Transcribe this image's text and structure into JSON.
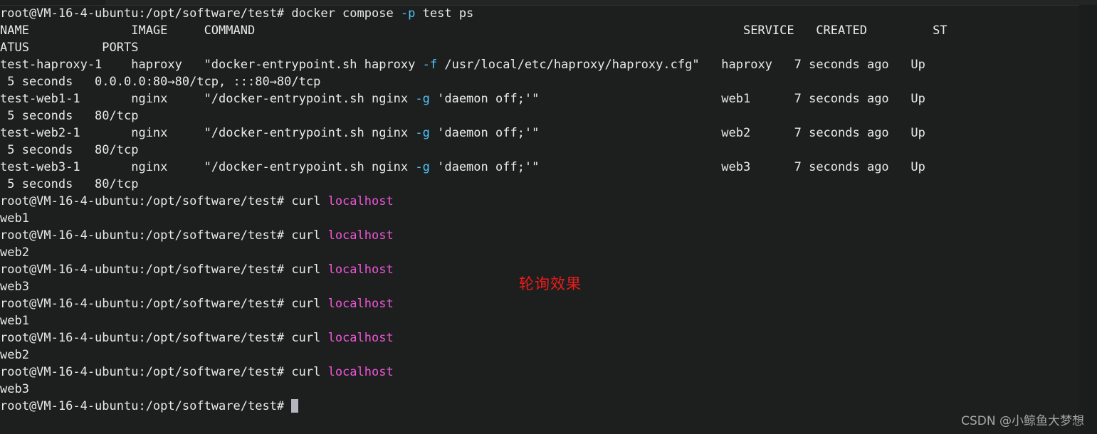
{
  "terminal": {
    "background_color": "#1d1f1f",
    "foreground_color": "#e9e9e9",
    "accent_cyan": "#4fc3f7",
    "accent_magenta": "#f056d9",
    "annotation_color": "#ee1b1b",
    "prompt": "root@VM-16-4-ubuntu:/opt/software/test#",
    "hostname": "VM-16-4-ubuntu",
    "user": "root",
    "cwd": "/opt/software/test"
  },
  "lines": [
    {
      "id": "line-0",
      "segments": [
        {
          "text": "root@VM-16-4-ubuntu:/opt/software/test# docker compose ",
          "color": "default"
        },
        {
          "text": "-p",
          "color": "cyan"
        },
        {
          "text": " test ps",
          "color": "default"
        }
      ]
    },
    {
      "id": "line-1",
      "segments": [
        {
          "text": "NAME              IMAGE     COMMAND                                                                   SERVICE   CREATED         ST",
          "color": "default"
        }
      ]
    },
    {
      "id": "line-2",
      "segments": [
        {
          "text": "ATUS          PORTS",
          "color": "default"
        }
      ]
    },
    {
      "id": "line-3",
      "segments": [
        {
          "text": "test-haproxy-1    haproxy   \"docker-entrypoint.sh haproxy ",
          "color": "default"
        },
        {
          "text": "-f",
          "color": "cyan"
        },
        {
          "text": " /usr/local/etc/haproxy/haproxy.cfg\"   haproxy   7 seconds ago   Up",
          "color": "default"
        }
      ]
    },
    {
      "id": "line-4",
      "segments": [
        {
          "text": " 5 seconds   0.0.0.0:80→80/tcp, :::80→80/tcp",
          "color": "default"
        }
      ]
    },
    {
      "id": "line-5",
      "segments": [
        {
          "text": "test-web1-1       nginx     \"/docker-entrypoint.sh nginx ",
          "color": "default"
        },
        {
          "text": "-g",
          "color": "cyan"
        },
        {
          "text": " 'daemon off;'\"                         web1      7 seconds ago   Up",
          "color": "default"
        }
      ]
    },
    {
      "id": "line-6",
      "segments": [
        {
          "text": " 5 seconds   80/tcp",
          "color": "default"
        }
      ]
    },
    {
      "id": "line-7",
      "segments": [
        {
          "text": "test-web2-1       nginx     \"/docker-entrypoint.sh nginx ",
          "color": "default"
        },
        {
          "text": "-g",
          "color": "cyan"
        },
        {
          "text": " 'daemon off;'\"                         web2      7 seconds ago   Up",
          "color": "default"
        }
      ]
    },
    {
      "id": "line-8",
      "segments": [
        {
          "text": " 5 seconds   80/tcp",
          "color": "default"
        }
      ]
    },
    {
      "id": "line-9",
      "segments": [
        {
          "text": "test-web3-1       nginx     \"/docker-entrypoint.sh nginx ",
          "color": "default"
        },
        {
          "text": "-g",
          "color": "cyan"
        },
        {
          "text": " 'daemon off;'\"                         web3      7 seconds ago   Up",
          "color": "default"
        }
      ]
    },
    {
      "id": "line-10",
      "segments": [
        {
          "text": " 5 seconds   80/tcp",
          "color": "default"
        }
      ]
    },
    {
      "id": "line-11",
      "segments": [
        {
          "text": "root@VM-16-4-ubuntu:/opt/software/test# curl ",
          "color": "default"
        },
        {
          "text": "localhost",
          "color": "magenta"
        }
      ]
    },
    {
      "id": "line-12",
      "segments": [
        {
          "text": "web1",
          "color": "default"
        }
      ]
    },
    {
      "id": "line-13",
      "segments": [
        {
          "text": "root@VM-16-4-ubuntu:/opt/software/test# curl ",
          "color": "default"
        },
        {
          "text": "localhost",
          "color": "magenta"
        }
      ]
    },
    {
      "id": "line-14",
      "segments": [
        {
          "text": "web2",
          "color": "default"
        }
      ]
    },
    {
      "id": "line-15",
      "segments": [
        {
          "text": "root@VM-16-4-ubuntu:/opt/software/test# curl ",
          "color": "default"
        },
        {
          "text": "localhost",
          "color": "magenta"
        }
      ]
    },
    {
      "id": "line-16",
      "segments": [
        {
          "text": "web3",
          "color": "default"
        }
      ]
    },
    {
      "id": "line-17",
      "segments": [
        {
          "text": "root@VM-16-4-ubuntu:/opt/software/test# curl ",
          "color": "default"
        },
        {
          "text": "localhost",
          "color": "magenta"
        }
      ]
    },
    {
      "id": "line-18",
      "segments": [
        {
          "text": "web1",
          "color": "default"
        }
      ]
    },
    {
      "id": "line-19",
      "segments": [
        {
          "text": "root@VM-16-4-ubuntu:/opt/software/test# curl ",
          "color": "default"
        },
        {
          "text": "localhost",
          "color": "magenta"
        }
      ]
    },
    {
      "id": "line-20",
      "segments": [
        {
          "text": "web2",
          "color": "default"
        }
      ]
    },
    {
      "id": "line-21",
      "segments": [
        {
          "text": "root@VM-16-4-ubuntu:/opt/software/test# curl ",
          "color": "default"
        },
        {
          "text": "localhost",
          "color": "magenta"
        }
      ]
    },
    {
      "id": "line-22",
      "segments": [
        {
          "text": "web3",
          "color": "default"
        }
      ]
    },
    {
      "id": "line-23",
      "segments": [
        {
          "text": "root@VM-16-4-ubuntu:/opt/software/test# ",
          "color": "default"
        },
        {
          "text": "",
          "color": "default",
          "cursor": true
        }
      ]
    }
  ],
  "docker_ps_table": {
    "headers": [
      "NAME",
      "IMAGE",
      "COMMAND",
      "SERVICE",
      "CREATED",
      "STATUS",
      "PORTS"
    ],
    "rows": [
      {
        "name": "test-haproxy-1",
        "image": "haproxy",
        "command": "\"docker-entrypoint.sh haproxy -f /usr/local/etc/haproxy/haproxy.cfg\"",
        "service": "haproxy",
        "created": "7 seconds ago",
        "status": "Up 5 seconds",
        "ports": "0.0.0.0:80→80/tcp, :::80→80/tcp"
      },
      {
        "name": "test-web1-1",
        "image": "nginx",
        "command": "\"/docker-entrypoint.sh nginx -g 'daemon off;'\"",
        "service": "web1",
        "created": "7 seconds ago",
        "status": "Up 5 seconds",
        "ports": "80/tcp"
      },
      {
        "name": "test-web2-1",
        "image": "nginx",
        "command": "\"/docker-entrypoint.sh nginx -g 'daemon off;'\"",
        "service": "web2",
        "created": "7 seconds ago",
        "status": "Up 5 seconds",
        "ports": "80/tcp"
      },
      {
        "name": "test-web3-1",
        "image": "nginx",
        "command": "\"/docker-entrypoint.sh nginx -g 'daemon off;'\"",
        "service": "web3",
        "created": "7 seconds ago",
        "status": "Up 5 seconds",
        "ports": "80/tcp"
      }
    ]
  },
  "commands_run": [
    "docker compose -p test ps",
    "curl localhost",
    "curl localhost",
    "curl localhost",
    "curl localhost",
    "curl localhost",
    "curl localhost"
  ],
  "curl_responses": [
    "web1",
    "web2",
    "web3",
    "web1",
    "web2",
    "web3"
  ],
  "annotation": {
    "text": "轮询效果",
    "color": "#ee1b1b"
  },
  "watermark": {
    "text": "CSDN @小鲸鱼大梦想"
  }
}
